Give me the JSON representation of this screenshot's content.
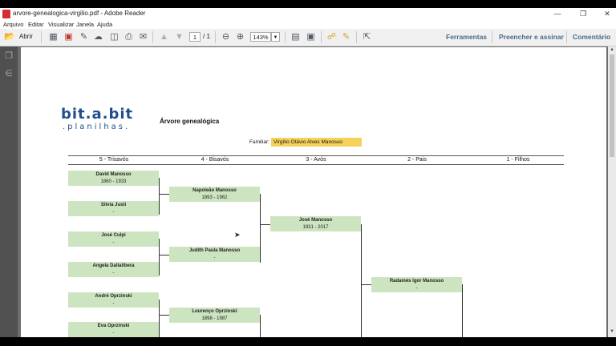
{
  "window": {
    "title": "arvore-genealogica-virgilio.pdf - Adobe Reader",
    "minimize": "—",
    "restore": "❐",
    "close": "✕"
  },
  "menu": [
    "Arquivo",
    "Editar",
    "Visualizar",
    "Janela",
    "Ajuda"
  ],
  "toolbar": {
    "open_label": "Abrir",
    "page_current": "1",
    "page_total": "/ 1",
    "zoom": "143%",
    "links": [
      "Ferramentas",
      "Preencher e assinar",
      "Comentário"
    ]
  },
  "document": {
    "logo_main": "bit.a.bit",
    "logo_sub": ".planilhas.",
    "title": "Árvore genealógica",
    "familiar_label": "Familiar:",
    "familiar_value": "Virgílio Otávio Alves Manosso",
    "columns": [
      "5 - Trisavós",
      "4 - Bisavós",
      "3 - Avós",
      "2 - Pais",
      "1 - Filhos"
    ],
    "gen5": [
      {
        "name": "David Manosso",
        "dates": "1860 - 1933"
      },
      {
        "name": "Silvia Justi",
        "dates": "-"
      },
      {
        "name": "José Culpi",
        "dates": "-"
      },
      {
        "name": "Angela Dallalibera",
        "dates": "-"
      },
      {
        "name": "André Oprzinski",
        "dates": "-"
      },
      {
        "name": "Eva Oprzinski",
        "dates": "-"
      }
    ],
    "gen4": [
      {
        "name": "Napoleão Manosso",
        "dates": "1893 - 1962"
      },
      {
        "name": "Judith Paula Manosso",
        "dates": "-"
      },
      {
        "name": "Lourenço Oprzinski",
        "dates": "1898 - 1987"
      }
    ],
    "gen3": [
      {
        "name": "José Manosso",
        "dates": "1931 - 2017"
      }
    ],
    "gen2": [
      {
        "name": "Radamés Igor Manosso",
        "dates": "-"
      }
    ]
  }
}
